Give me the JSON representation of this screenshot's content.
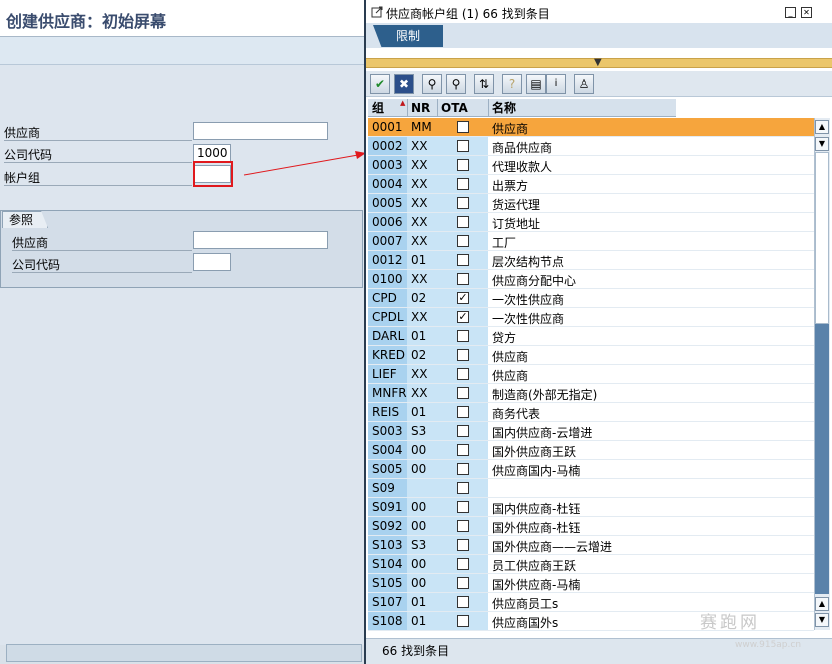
{
  "main": {
    "title": "创建供应商：初始屏幕",
    "fields": {
      "vendor_label": "供应商",
      "vendor_value": "",
      "company_code_label": "公司代码",
      "company_code_value": "1000",
      "account_group_label": "帐户组",
      "account_group_value": ""
    },
    "reference": {
      "tab_label": "参照",
      "vendor_label": "供应商",
      "vendor_value": "",
      "company_code_label": "公司代码",
      "company_code_value": ""
    }
  },
  "popup": {
    "title": "供应商帐户组 (1)   66 找到条目",
    "tab_label": "限制",
    "toolbar": {
      "icons": [
        "check-icon",
        "cancel-icon",
        "find-icon",
        "find-next-icon",
        "sort-icon",
        "help-icon",
        "print-icon",
        "info-icon",
        "personal-list-icon"
      ]
    },
    "columns": [
      "组",
      "NR",
      "OTA",
      "名称"
    ],
    "rows": [
      {
        "group": "0001",
        "nr": "MM",
        "ota": false,
        "name": "供应商",
        "selected": true
      },
      {
        "group": "0002",
        "nr": "XX",
        "ota": false,
        "name": "商品供应商"
      },
      {
        "group": "0003",
        "nr": "XX",
        "ota": false,
        "name": "代理收款人"
      },
      {
        "group": "0004",
        "nr": "XX",
        "ota": false,
        "name": "出票方"
      },
      {
        "group": "0005",
        "nr": "XX",
        "ota": false,
        "name": "货运代理"
      },
      {
        "group": "0006",
        "nr": "XX",
        "ota": false,
        "name": "订货地址"
      },
      {
        "group": "0007",
        "nr": "XX",
        "ota": false,
        "name": "工厂"
      },
      {
        "group": "0012",
        "nr": "01",
        "ota": false,
        "name": "层次结构节点"
      },
      {
        "group": "0100",
        "nr": "XX",
        "ota": false,
        "name": "供应商分配中心"
      },
      {
        "group": "CPD",
        "nr": "02",
        "ota": true,
        "name": "一次性供应商"
      },
      {
        "group": "CPDL",
        "nr": "XX",
        "ota": true,
        "name": "一次性供应商"
      },
      {
        "group": "DARL",
        "nr": "01",
        "ota": false,
        "name": "贷方"
      },
      {
        "group": "KRED",
        "nr": "02",
        "ota": false,
        "name": "供应商"
      },
      {
        "group": "LIEF",
        "nr": "XX",
        "ota": false,
        "name": "供应商"
      },
      {
        "group": "MNFR",
        "nr": "XX",
        "ota": false,
        "name": "制造商(外部无指定)"
      },
      {
        "group": "REIS",
        "nr": "01",
        "ota": false,
        "name": "商务代表"
      },
      {
        "group": "S003",
        "nr": "S3",
        "ota": false,
        "name": "国内供应商-云增进"
      },
      {
        "group": "S004",
        "nr": "00",
        "ota": false,
        "name": "国外供应商王跃"
      },
      {
        "group": "S005",
        "nr": "00",
        "ota": false,
        "name": "供应商国内-马楠"
      },
      {
        "group": "S09",
        "nr": "",
        "ota": false,
        "name": ""
      },
      {
        "group": "S091",
        "nr": "00",
        "ota": false,
        "name": "国内供应商-杜钰"
      },
      {
        "group": "S092",
        "nr": "00",
        "ota": false,
        "name": "国外供应商-杜钰"
      },
      {
        "group": "S103",
        "nr": "S3",
        "ota": false,
        "name": "国外供应商——云增进"
      },
      {
        "group": "S104",
        "nr": "00",
        "ota": false,
        "name": "员工供应商王跃"
      },
      {
        "group": "S105",
        "nr": "00",
        "ota": false,
        "name": "国外供应商-马楠"
      },
      {
        "group": "S107",
        "nr": "01",
        "ota": false,
        "name": "供应商员工s"
      },
      {
        "group": "S108",
        "nr": "01",
        "ota": false,
        "name": "供应商国外s"
      }
    ],
    "status": "66 找到条目"
  },
  "watermark": {
    "text": "赛跑网",
    "url": "www.915ap.cn"
  },
  "colors": {
    "title_text": "#3a4c6e",
    "selection": "#f6a53d",
    "tab_active": "#2d5f8c",
    "highlight_box": "#e0191d",
    "key_column": "#a9d2ef"
  }
}
